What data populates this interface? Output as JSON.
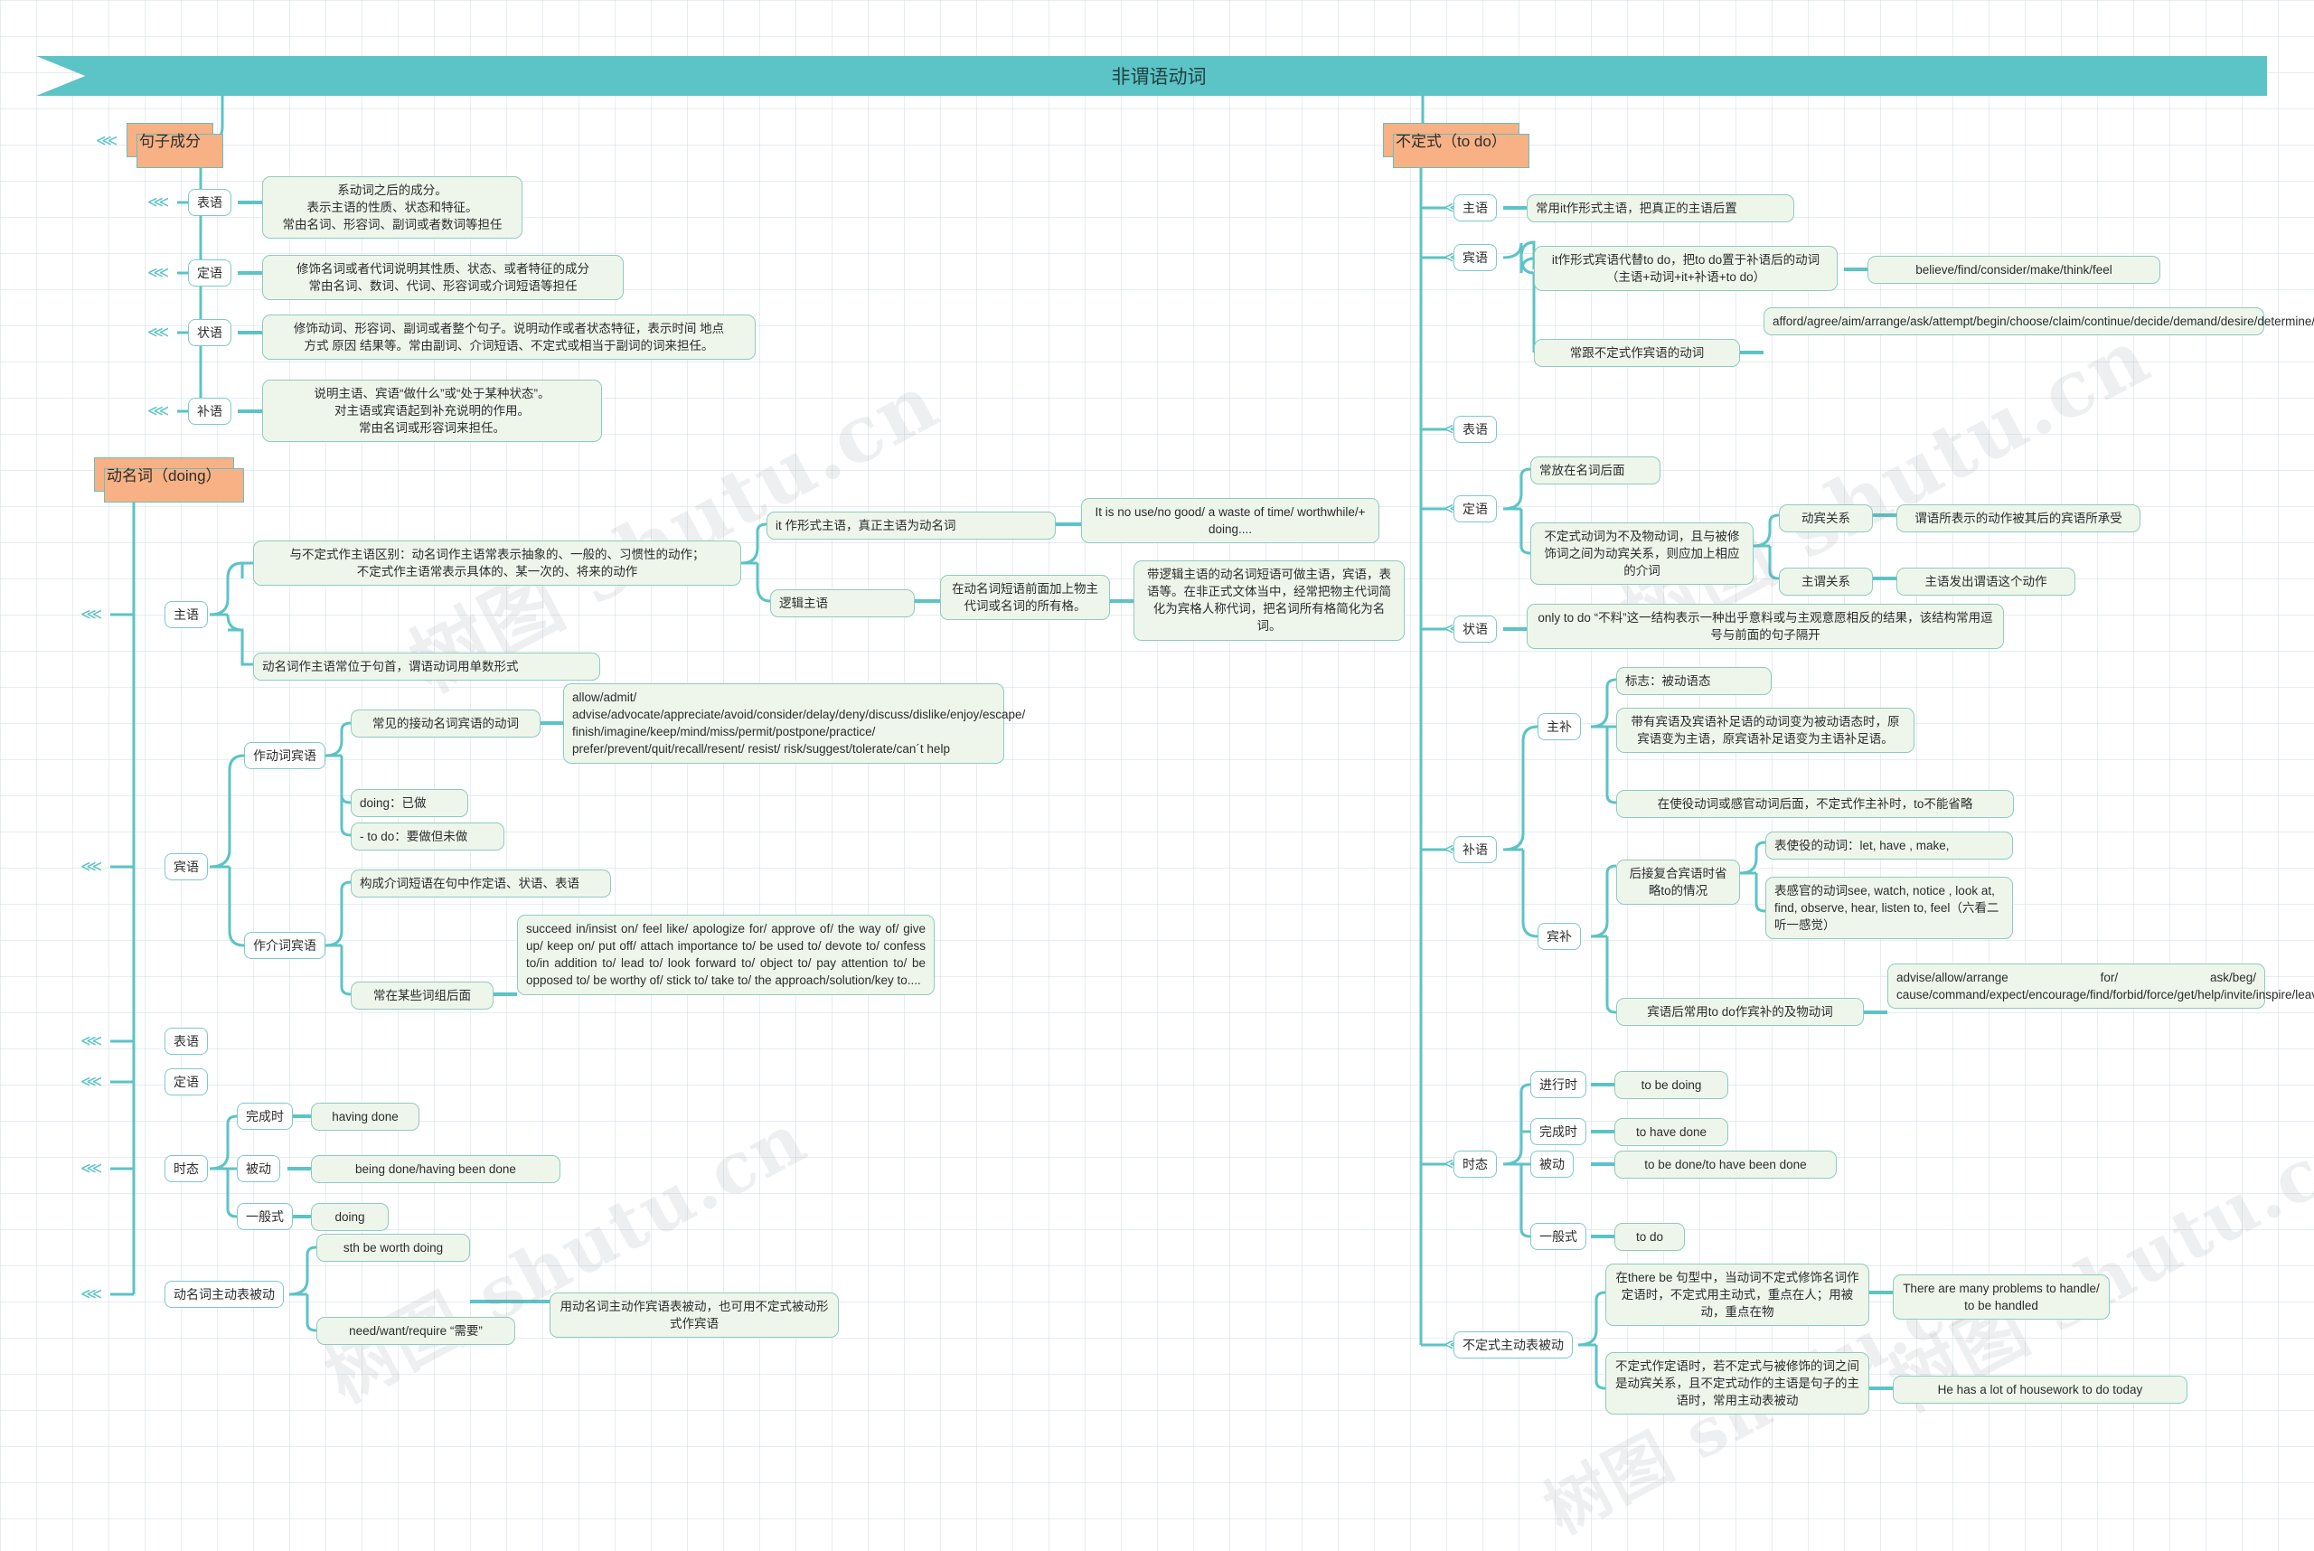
{
  "banner": {
    "title": "非谓语动词"
  },
  "watermarks": [
    {
      "text": "树图 shutu.cn"
    },
    {
      "text": "树图 shutu.cn"
    },
    {
      "text": "树图 shutu.cn"
    },
    {
      "text": "树图 shutu.cn"
    },
    {
      "text": "树图 shutu.cn"
    }
  ],
  "roots": {
    "sentence_parts": "句子成分",
    "gerund": "动名词（doing）",
    "infinitive": "不定式（to do）"
  },
  "sentence_parts": {
    "items": [
      {
        "label": "表语",
        "text": "系动词之后的成分。\n表示主语的性质、状态和特征。\n常由名词、形容词、副词或者数词等担任"
      },
      {
        "label": "定语",
        "text": "修饰名词或者代词说明其性质、状态、或者特征的成分\n常由名词、数词、代词、形容词或介词短语等担任"
      },
      {
        "label": "状语",
        "text": "修饰动词、形容词、副词或者整个句子。说明动作或者状态特征，表示时间 地点\n方式 原因 结果等。常由副词、介词短语、不定式或相当于副词的词来担任。"
      },
      {
        "label": "补语",
        "text": "说明主语、宾语“做什么”或“处于某种状态”。\n对主语或宾语起到补充说明的作用。\n常由名词或形容词来担任。"
      }
    ]
  },
  "gerund": {
    "subject": {
      "label": "主语",
      "compare": "与不定式作主语区别：动名词作主语常表示抽象的、一般的、习惯性的动作；\n不定式作主语常表示具体的、某一次的、将来的动作",
      "formal_subject": {
        "label": "it 作形式主语，真正主语为动名词",
        "example": "It is no use/no good/ a waste of time/ worthwhile/+ doing...."
      },
      "logical_subject": {
        "label": "逻辑主语",
        "rule": "在动名词短语前面加上物主代词或名词的所有格。",
        "detail": "带逻辑主语的动名词短语可做主语，宾语，表语等。在非正式文体当中，经常把物主代词简化为宾格人称代词，把名词所有格简化为名词。"
      },
      "position": "动名词作主语常位于句首，谓语动词用单数形式"
    },
    "object": {
      "label": "宾语",
      "verb_object": {
        "label": "作动词宾语",
        "common_verbs_label": "常见的接动名词宾语的动词",
        "common_verbs": "allow/admit/ advise/advocate/appreciate/avoid/consider/delay/deny/discuss/dislike/enjoy/escape/ finish/imagine/keep/mind/miss/permit/postpone/practice/ prefer/prevent/quit/recall/resent/ resist/ risk/suggest/tolerate/can´t help",
        "doing": "doing：已做",
        "todo": "- to do：要做但未做"
      },
      "prep_object": {
        "label": "作介词宾语",
        "function": "构成介词短语在句中作定语、状语、表语",
        "phrases_label": "常在某些词组后面",
        "phrases": "succeed in/insist on/ feel like/ apologize for/ approve of/ the way of/ give up/ keep on/ put off/ attach importance to/ be used to/ devote to/ confess to/in addition to/ lead to/ look forward to/ object to/ pay attention to/ be opposed to/ be worthy of/ stick to/ take to/ the approach/solution/key to...."
      }
    },
    "predicative": "表语",
    "attributive": "定语",
    "tense": {
      "label": "时态",
      "items": [
        {
          "label": "完成时",
          "value": "having done"
        },
        {
          "label": "被动",
          "value": "being done/having been done"
        },
        {
          "label": "一般式",
          "value": "doing"
        }
      ]
    },
    "active_passive": {
      "label": "动名词主动表被动",
      "items": [
        {
          "text": "sth be worth doing"
        },
        {
          "text": "need/want/require “需要”"
        }
      ],
      "note": "用动名词主动作宾语表被动，也可用不定式被动形式作宾语"
    }
  },
  "infinitive": {
    "subject": {
      "label": "主语",
      "text": "常用it作形式主语，把真正的主语后置"
    },
    "object": {
      "label": "宾语",
      "formal": {
        "text": "it作形式宾语代替to do，把to do置于补语后的动词（主语+动词+it+补语+to do）",
        "verbs": "believe/find/consider/make/think/feel"
      },
      "common": {
        "text": "常跟不定式作宾语的动词",
        "verbs": "afford/agree/aim/arrange/ask/attempt/begin/choose/claim/continue/decide/demand/desire/determine/expect/fail/forget/happen/hate/hesitate/hope/intend/learn/like/love/manage/mean/offer/plan/prepare/pretend/promise/prove/refuse/seem/start/try/undertake/want/wish"
      }
    },
    "predicative": {
      "label": "表语"
    },
    "attributive": {
      "label": "定语",
      "after_noun": "常放在名词后面",
      "relation_text": "不定式动词为不及物动词，且与被修饰词之间为动宾关系，则应加上相应的介词",
      "relations": [
        {
          "label": "动宾关系",
          "value": "谓语所表示的动作被其后的宾语所承受"
        },
        {
          "label": "主谓关系",
          "value": "主语发出谓语这个动作"
        }
      ]
    },
    "adverbial": {
      "label": "状语",
      "text": "only to do “不料”这一结构表示一种出乎意料或与主观意愿相反的结果，该结构常用逗号与前面的句子隔开"
    },
    "complement": {
      "label": "补语",
      "subject_comp": {
        "label": "主补",
        "mark": "标志：被动语态",
        "text1": "带有宾语及宾语补足语的动词变为被动语态时，原宾语变为主语，原宾语补足语变为主语补足语。",
        "text2": "在使役动词或感官动词后面，不定式作主补时，to不能省略"
      },
      "object_comp": {
        "label": "宾补",
        "omit_to_label": "后接复合宾语时省略to的情况",
        "causative": "表使役的动词：let, have , make,",
        "perception": "表感官的动词see, watch, notice , look at, find, observe, hear, listen to, feel（六看二听一感觉）",
        "with_to": "宾语后常用to do作宾补的及物动词",
        "with_to_verbs": "advise/allow/arrange for/ ask/beg/ cause/command/expect/encourage/find/forbid/force/get/help/invite/inspire/leave/lead/order/permit/persuade/prefer/remind/request/require/teach/tell/urge/want/warn/wish"
      }
    },
    "tense": {
      "label": "时态",
      "items": [
        {
          "label": "进行时",
          "value": "to be doing"
        },
        {
          "label": "完成时",
          "value": "to have done"
        },
        {
          "label": "被动",
          "value": "to be done/to have been done"
        },
        {
          "label": "一般式",
          "value": "to do"
        }
      ]
    },
    "active_passive": {
      "label": "不定式主动表被动",
      "items": [
        {
          "text": "在there be 句型中，当动词不定式修饰名词作定语时，不定式用主动式，重点在人；用被动，重点在物",
          "example": "There are many problems to handle/ to be handled"
        },
        {
          "text": "不定式作定语时，若不定式与被修饰的词之间是动宾关系，且不定式动作的主语是句子的主语时，常用主动表被动",
          "example": "He has a lot of housework to do today"
        }
      ]
    }
  }
}
